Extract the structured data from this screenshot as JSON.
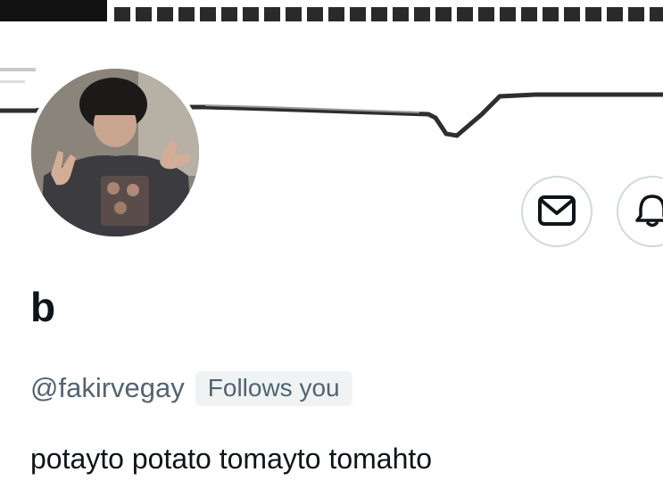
{
  "profile": {
    "display_name": "b",
    "handle": "@fakirvegay",
    "follows_badge": "Follows you",
    "bio": "potayto potato tomayto tomahto"
  },
  "actions": {
    "message_icon": "mail-icon",
    "notify_icon": "bell-icon"
  },
  "colors": {
    "text_primary": "#0f1419",
    "text_secondary": "#536471",
    "border": "#cfd9de",
    "badge_bg": "#eff3f4"
  }
}
